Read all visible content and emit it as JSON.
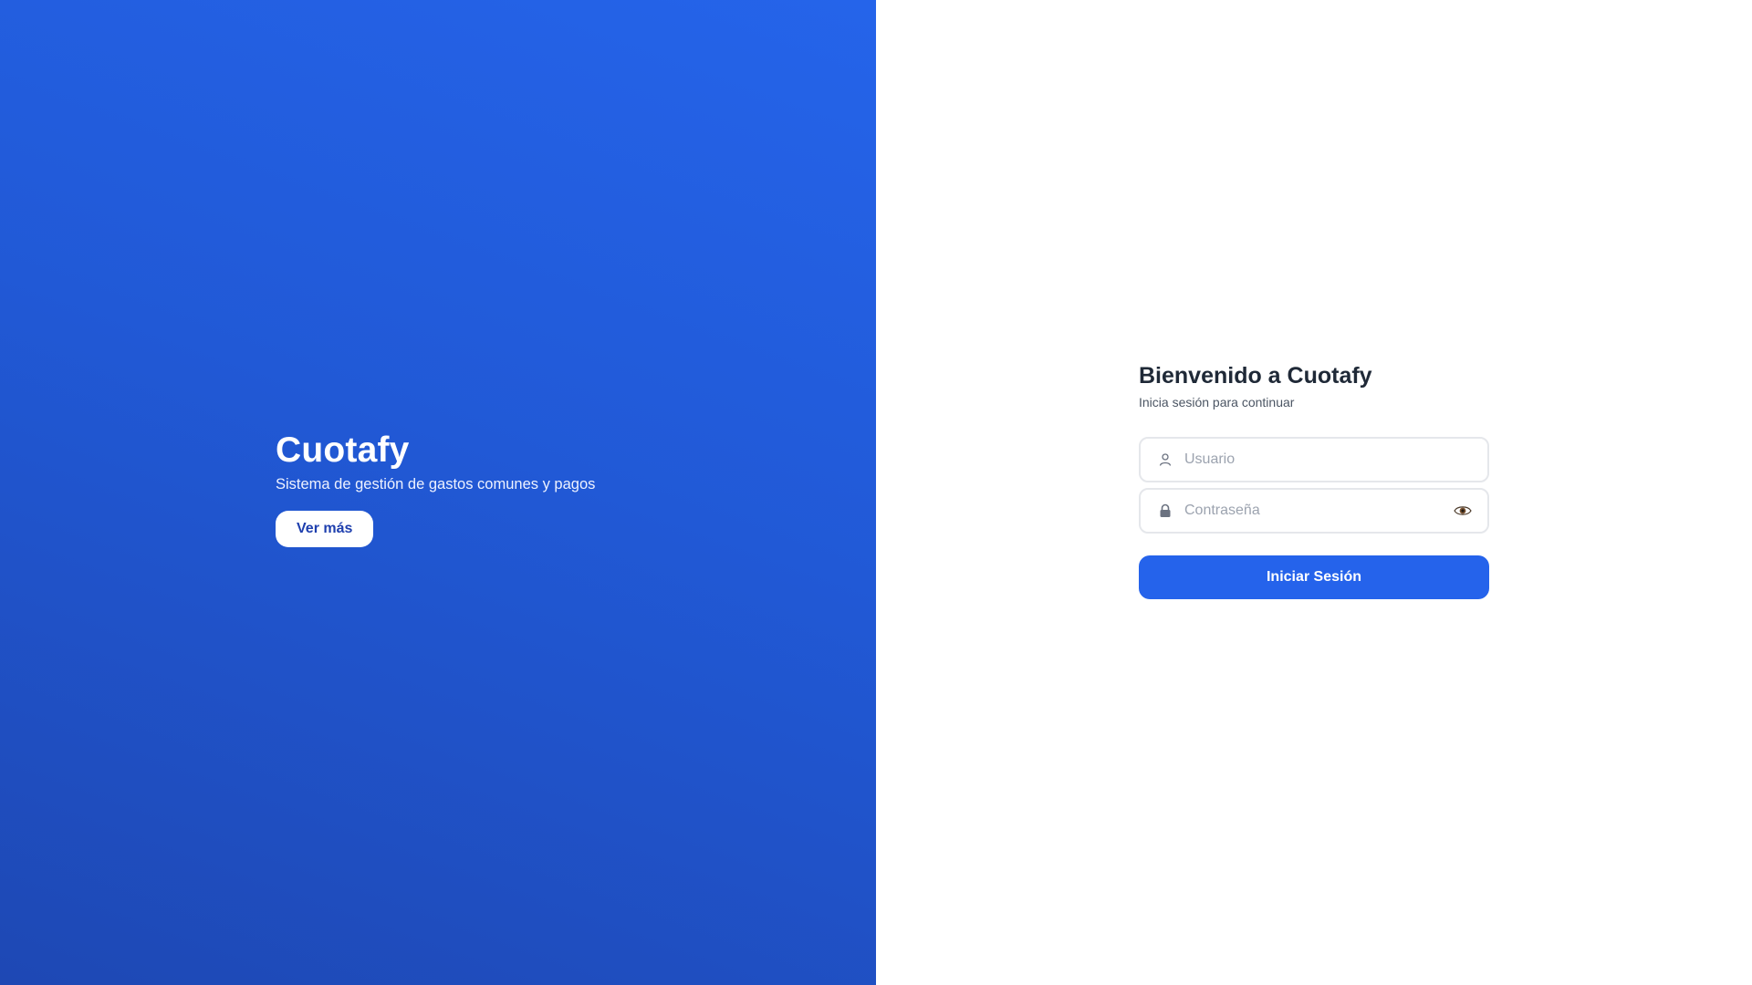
{
  "hero": {
    "title": "Cuotafy",
    "subtitle": "Sistema de gestión de gastos comunes y pagos",
    "cta_label": "Ver más"
  },
  "login": {
    "title": "Bienvenido a Cuotafy",
    "subtitle": "Inicia sesión para continuar",
    "username": {
      "value": "",
      "placeholder": "Usuario",
      "icon": "user-icon"
    },
    "password": {
      "value": "",
      "placeholder": "Contraseña",
      "icon": "lock-icon",
      "toggle_icon": "eye-icon"
    },
    "submit_label": "Iniciar Sesión"
  },
  "colors": {
    "hero_gradient_start": "#1e48b4",
    "hero_gradient_end": "#2564ea",
    "primary": "#2563eb",
    "title_text": "#1f2937",
    "muted_text": "#4b5563",
    "border": "#e5e7eb"
  }
}
